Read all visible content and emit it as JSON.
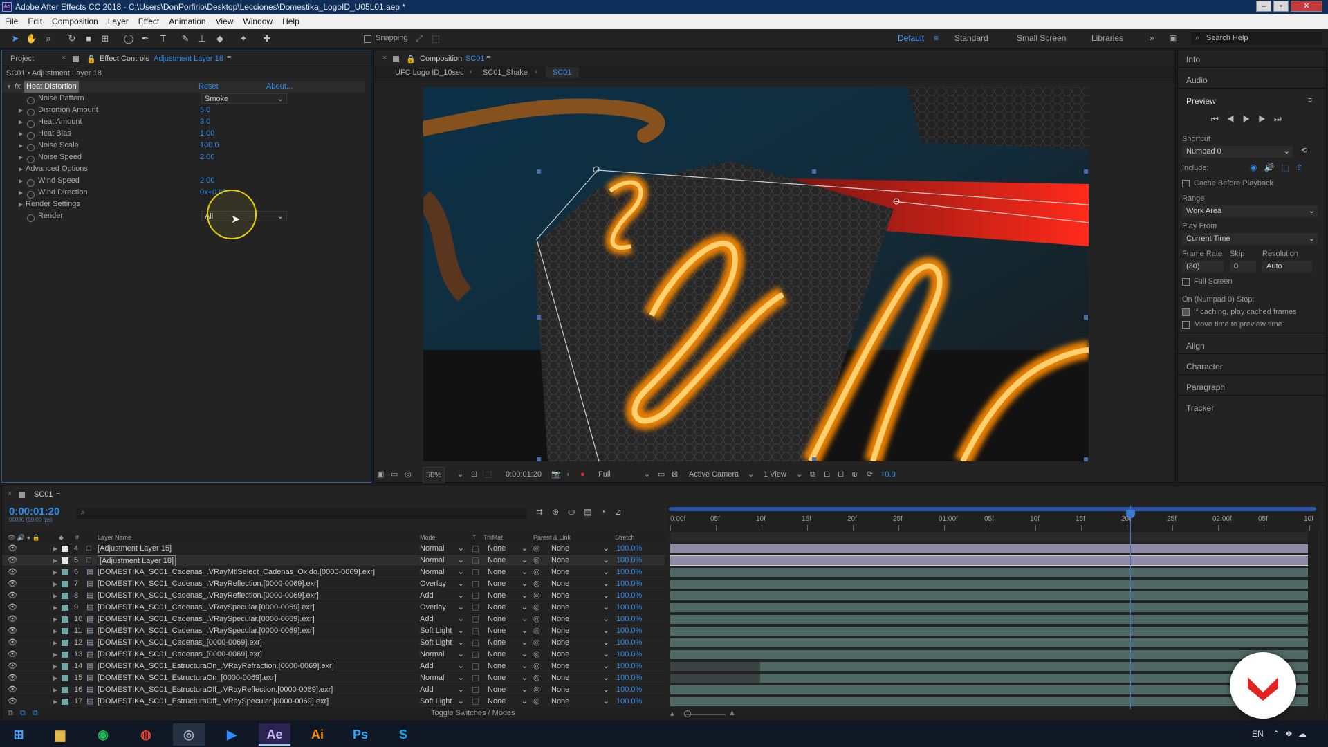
{
  "title_bar": {
    "text": "Adobe After Effects CC 2018 - C:\\Users\\DonPorfirio\\Desktop\\Lecciones\\Domestika_LogoID_U05L01.aep *"
  },
  "menu": [
    "File",
    "Edit",
    "Composition",
    "Layer",
    "Effect",
    "Animation",
    "View",
    "Window",
    "Help"
  ],
  "toolbar": {
    "snapping": "Snapping",
    "workspaces": [
      "Default",
      "Standard",
      "Small Screen",
      "Libraries"
    ],
    "search_placeholder": "Search Help"
  },
  "left_panel": {
    "tab_project": "Project",
    "tab_effect_controls": "Effect Controls",
    "tab_effect_layer": "Adjustment Layer 18",
    "breadcrumb": "SC01 • Adjustment Layer 18",
    "effect": {
      "name": "Heat Distortion",
      "reset": "Reset",
      "about": "About..."
    },
    "props": [
      {
        "label": "Noise Pattern",
        "value": "Smoke"
      },
      {
        "label": "Distortion Amount",
        "value": "5.0"
      },
      {
        "label": "Heat Amount",
        "value": "3.0"
      },
      {
        "label": "Heat Bias",
        "value": "1.00"
      },
      {
        "label": "Noise Scale",
        "value": "100.0"
      },
      {
        "label": "Noise Speed",
        "value": "2.00"
      },
      {
        "label": "Advanced Options",
        "value": ""
      },
      {
        "label": "Wind Speed",
        "value": "2.00"
      },
      {
        "label": "Wind Direction",
        "value": "0x+0.0°"
      },
      {
        "label": "Render Settings",
        "value": ""
      },
      {
        "label": "Render",
        "value": "All"
      }
    ]
  },
  "comp_panel": {
    "tab": "Composition",
    "tab_comp": "SC01",
    "crumbs": [
      "UFC Logo ID_10sec",
      "SC01_Shake",
      "SC01"
    ],
    "footer": {
      "zoom": "50%",
      "timecode": "0:00:01:20",
      "quality": "Full",
      "camera": "Active Camera",
      "view": "1 View",
      "exposure": "+0.0"
    }
  },
  "right_panel": {
    "info": "Info",
    "audio": "Audio",
    "preview": "Preview",
    "shortcut_label": "Shortcut",
    "shortcut": "Numpad 0",
    "include": "Include:",
    "cache_before": "Cache Before Playback",
    "range_label": "Range",
    "range": "Work Area",
    "play_from_label": "Play From",
    "play_from": "Current Time",
    "frame_rate_label": "Frame Rate",
    "skip_label": "Skip",
    "resolution_label": "Resolution",
    "frame_rate": "(30)",
    "skip": "0",
    "resolution": "Auto",
    "full_screen": "Full Screen",
    "stop_label": "On (Numpad 0) Stop:",
    "if_caching": "If caching, play cached frames",
    "move_time": "Move time to preview time",
    "align": "Align",
    "character": "Character",
    "paragraph": "Paragraph",
    "tracker": "Tracker"
  },
  "timeline": {
    "tab": "SC01",
    "timecode": "0:00:01:20",
    "timecode_sub": "00050 (30.00 fps)",
    "headers": {
      "layer_name": "Layer Name",
      "mode": "Mode",
      "t": "T",
      "trkmat": "TrkMat",
      "parent": "Parent & Link",
      "stretch": "Stretch"
    },
    "ruler": [
      "0:00f",
      "05f",
      "10f",
      "15f",
      "20f",
      "25f",
      "01:00f",
      "05f",
      "10f",
      "15f",
      "20f",
      "25f",
      "02:00f",
      "05f",
      "10f"
    ],
    "toggle": "Toggle Switches / Modes",
    "layers": [
      {
        "num": "4",
        "name": "[Adjustment Layer 15]",
        "mode": "Normal",
        "trk": "None",
        "parent": "None",
        "stretch": "100.0%",
        "adj": true
      },
      {
        "num": "5",
        "name": "[Adjustment Layer 18]",
        "mode": "Normal",
        "trk": "None",
        "parent": "None",
        "stretch": "100.0%",
        "adj": true,
        "selected": true
      },
      {
        "num": "6",
        "name": "[DOMESTIKA_SC01_Cadenas_.VRayMtlSelect_Cadenas_Oxido.[0000-0069].exr]",
        "mode": "Normal",
        "trk": "None",
        "parent": "None",
        "stretch": "100.0%"
      },
      {
        "num": "7",
        "name": "[DOMESTIKA_SC01_Cadenas_.VRayReflection.[0000-0069].exr]",
        "mode": "Overlay",
        "trk": "None",
        "parent": "None",
        "stretch": "100.0%"
      },
      {
        "num": "8",
        "name": "[DOMESTIKA_SC01_Cadenas_.VRayReflection.[0000-0069].exr]",
        "mode": "Add",
        "trk": "None",
        "parent": "None",
        "stretch": "100.0%"
      },
      {
        "num": "9",
        "name": "[DOMESTIKA_SC01_Cadenas_.VRaySpecular.[0000-0069].exr]",
        "mode": "Overlay",
        "trk": "None",
        "parent": "None",
        "stretch": "100.0%"
      },
      {
        "num": "10",
        "name": "[DOMESTIKA_SC01_Cadenas_.VRaySpecular.[0000-0069].exr]",
        "mode": "Add",
        "trk": "None",
        "parent": "None",
        "stretch": "100.0%"
      },
      {
        "num": "11",
        "name": "[DOMESTIKA_SC01_Cadenas_.VRaySpecular.[0000-0069].exr]",
        "mode": "Soft Light",
        "trk": "None",
        "parent": "None",
        "stretch": "100.0%"
      },
      {
        "num": "12",
        "name": "[DOMESTIKA_SC01_Cadenas_[0000-0069].exr]",
        "mode": "Soft Light",
        "trk": "None",
        "parent": "None",
        "stretch": "100.0%"
      },
      {
        "num": "13",
        "name": "[DOMESTIKA_SC01_Cadenas_[0000-0069].exr]",
        "mode": "Normal",
        "trk": "None",
        "parent": "None",
        "stretch": "100.0%"
      },
      {
        "num": "14",
        "name": "[DOMESTIKA_SC01_EstructuraOn_.VRayRefraction.[0000-0069].exr]",
        "mode": "Add",
        "trk": "None",
        "parent": "None",
        "stretch": "100.0%",
        "short": true
      },
      {
        "num": "15",
        "name": "[DOMESTIKA_SC01_EstructuraOn_[0000-0069].exr]",
        "mode": "Normal",
        "trk": "None",
        "parent": "None",
        "stretch": "100.0%",
        "short": true
      },
      {
        "num": "16",
        "name": "[DOMESTIKA_SC01_EstructuraOff_.VRayReflection.[0000-0069].exr]",
        "mode": "Add",
        "trk": "None",
        "parent": "None",
        "stretch": "100.0%"
      },
      {
        "num": "17",
        "name": "[DOMESTIKA_SC01_EstructuraOff_.VRaySpecular.[0000-0069].exr]",
        "mode": "Soft Light",
        "trk": "None",
        "parent": "None",
        "stretch": "100.0%"
      }
    ]
  },
  "taskbar": {
    "lang": "EN",
    "apps": [
      "Ae",
      "Ai",
      "Ps"
    ]
  },
  "colors": {
    "accent": "#2d8ceb",
    "adjustment_bar": "#8f8aa6",
    "footage_bar": "#4f6a66",
    "playhead": "#3a7bd5"
  },
  "playhead_position": 0.72
}
